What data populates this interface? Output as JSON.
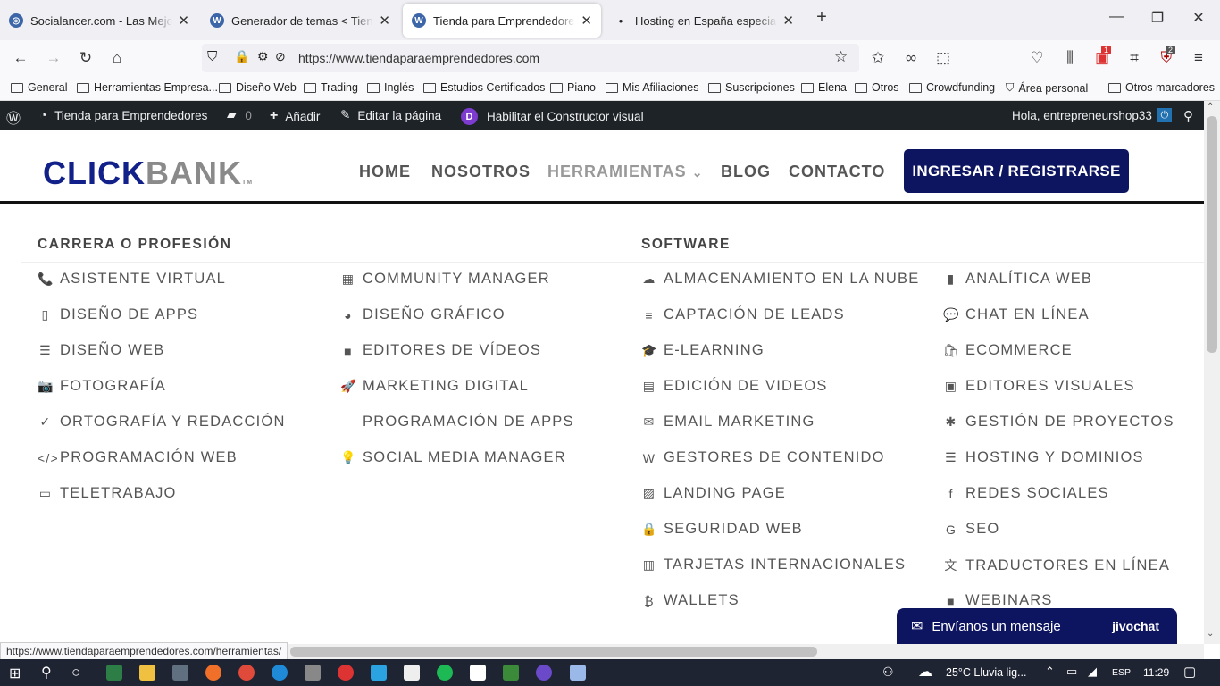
{
  "browser": {
    "tabs": [
      {
        "title": "Socialancer.com - Las Mejores H",
        "active": false
      },
      {
        "title": "Generador de temas < Tienda pa",
        "active": false
      },
      {
        "title": "Tienda para Emprendedores | Un",
        "active": true
      },
      {
        "title": "Hosting en España especializado",
        "active": false
      }
    ],
    "url": "https://www.tiendaparaemprendedores.com",
    "status_url": "https://www.tiendaparaemprendedores.com/herramientas/",
    "toolbar_badges": {
      "addon1": "1",
      "addon2": "2"
    }
  },
  "bookmarks": [
    "General",
    "Herramientas Empresa...",
    "Diseño Web",
    "Trading",
    "Inglés",
    "Estudios Certificados",
    "Piano",
    "Mis Afiliaciones",
    "Suscripciones",
    "Elena",
    "Otros",
    "Crowdfunding",
    "Área personal"
  ],
  "bookmarks_other": "Otros marcadores",
  "wpbar": {
    "site": "Tienda para Emprendedores",
    "comments": "0",
    "add": "Añadir",
    "edit": "Editar la página",
    "divi": "Habilitar el Constructor visual",
    "divi_letter": "D",
    "greeting": "Hola, entrepreneurshop33"
  },
  "site": {
    "logo_click": "CLICK",
    "logo_bank": "BANK",
    "logo_tm": "TM",
    "menu": [
      "HOME",
      "NOSOTROS",
      "HERRAMIENTAS",
      "BLOG",
      "CONTACTO"
    ],
    "menu_caret": "⌄",
    "cta": "INGRESAR / REGISTRARSE"
  },
  "megamenu": {
    "sec1": "CARRERA O PROFESIÓN",
    "sec2": "SOFTWARE",
    "col1": [
      "ASISTENTE VIRTUAL",
      "DISEÑO DE APPS",
      "DISEÑO WEB",
      "FOTOGRAFÍA",
      "ORTOGRAFÍA Y REDACCIÓN",
      "PROGRAMACIÓN WEB",
      "TELETRABAJO"
    ],
    "col2": [
      "COMMUNITY MANAGER",
      "DISEÑO GRÁFICO",
      "EDITORES DE VÍDEOS",
      "MARKETING DIGITAL",
      "PROGRAMACIÓN DE APPS",
      "SOCIAL MEDIA MANAGER"
    ],
    "col3": [
      "ALMACENAMIENTO EN LA NUBE",
      "CAPTACIÓN DE LEADS",
      "E-LEARNING",
      "EDICIÓN DE VIDEOS",
      "EMAIL MARKETING",
      "GESTORES DE CONTENIDO",
      "LANDING PAGE",
      "SEGURIDAD WEB",
      "TARJETAS INTERNACIONALES",
      "WALLETS"
    ],
    "col4": [
      "ANALÍTICA WEB",
      "CHAT EN LÍNEA",
      "ECOMMERCE",
      "EDITORES VISUALES",
      "GESTIÓN DE PROYECTOS",
      "HOSTING Y DOMINIOS",
      "REDES SOCIALES",
      "SEO",
      "TRADUCTORES EN LÍNEA",
      "WEBINARS"
    ]
  },
  "icons": {
    "col1": [
      "📞",
      "▯",
      "☰",
      "📷",
      "✓",
      "</>",
      "▭"
    ],
    "col2": [
      "▦",
      "◕",
      "■",
      "🚀",
      "",
      "💡"
    ],
    "col3": [
      "☁",
      "≡",
      "🎓",
      "▤",
      "✉",
      "W",
      "▨",
      "🔒",
      "▥",
      "₿"
    ],
    "col4": [
      "▮",
      "💬",
      "🛍",
      "▣",
      "✱",
      "☰",
      "f",
      "G",
      "文",
      "■"
    ]
  },
  "chat": {
    "label": "Envíanos un mensaje",
    "brand": "jivochat"
  },
  "taskbar": {
    "weather": "25°C  Lluvia lig...",
    "lang": "ESP",
    "time": "11:29"
  }
}
